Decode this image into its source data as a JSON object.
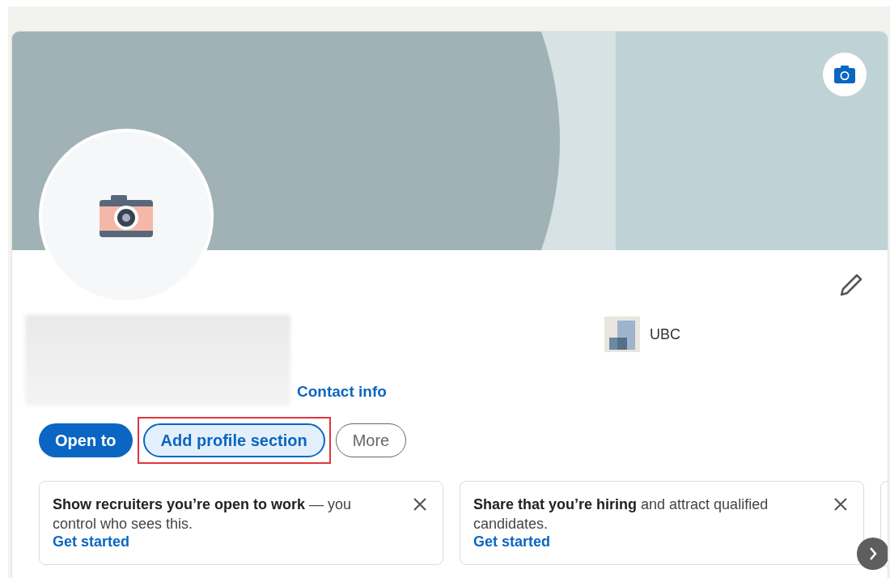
{
  "profile": {
    "contact_link": "Contact info",
    "school": "UBC"
  },
  "actions": [
    {
      "label": "Open to",
      "kind": "primary",
      "highlighted": false
    },
    {
      "label": "Add profile section",
      "kind": "secondary",
      "highlighted": true
    },
    {
      "label": "More",
      "kind": "tertiary",
      "highlighted": false
    }
  ],
  "suggestions": [
    {
      "text": "**Show recruiters you’re open to work** — you control who sees this.",
      "link": "Get started"
    },
    {
      "text": "**Share that you’re hiring** and attract qualified candidates.",
      "link": "Get started"
    }
  ]
}
